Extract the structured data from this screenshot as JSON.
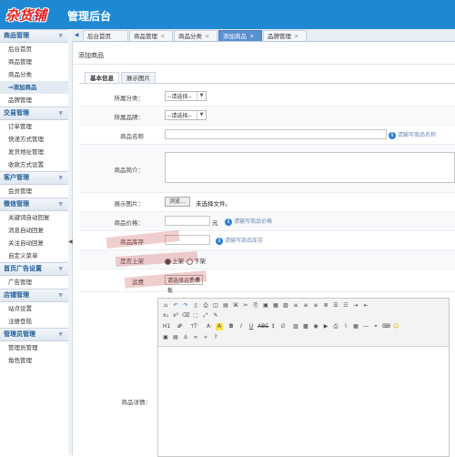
{
  "header": {
    "logo": "杂货铺",
    "title": "管理后台"
  },
  "sidebar": {
    "groups": [
      {
        "label": "商品管理",
        "items": [
          "后台首页",
          "商品管理",
          "商品分类",
          "添加商品",
          "品牌管理"
        ]
      },
      {
        "label": "交易管理",
        "items": [
          "订单管理",
          "快递方式管理",
          "发货地址管理",
          "收款方式设置"
        ]
      },
      {
        "label": "客户管理",
        "items": [
          "会员管理"
        ]
      },
      {
        "label": "微信管理",
        "items": [
          "关键词自动回复",
          "消息自动回复",
          "关注自动回复",
          "自定义菜单"
        ]
      },
      {
        "label": "首页广告设置",
        "items": [
          "广告管理"
        ]
      },
      {
        "label": "店铺管理",
        "items": [
          "站点设置",
          "注册登陆"
        ]
      },
      {
        "label": "管理员管理",
        "items": [
          "管理员管理",
          "角色管理"
        ]
      }
    ],
    "active_item": "添加商品"
  },
  "tabs": [
    {
      "label": "后台首页",
      "closable": false,
      "active": false
    },
    {
      "label": "商品管理",
      "closable": true,
      "active": false
    },
    {
      "label": "商品分类",
      "closable": true,
      "active": false
    },
    {
      "label": "添加商品",
      "closable": true,
      "active": true
    },
    {
      "label": "品牌管理",
      "closable": true,
      "active": false
    }
  ],
  "page": {
    "title": "添加商品",
    "subtabs": [
      "基本信息",
      "展示图片"
    ],
    "fields": {
      "category_label": "所属分类：",
      "category_value": "--请选择--",
      "brand_label": "所属品牌：",
      "brand_value": "--请选择--",
      "name_label": "商品名称",
      "name_tip": "请输写商品名称",
      "intro_label": "商品简介：",
      "image_label": "展示图片：",
      "browse_label": "浏览...",
      "no_file_text": "未选择文件。",
      "price_label": "商品价格：",
      "price_unit": "元",
      "price_tip": "请输写商品价格",
      "stock_label": "商品库存",
      "stock_tip": "请输写商品库存",
      "status_label": "是否上架",
      "status_yes": "上架",
      "status_no": "下架",
      "carrier_label": "运费",
      "carrier_value": "请选择运费模板",
      "detail_label": "商品详情："
    }
  },
  "colors": {
    "header_bg": "#1e88d3",
    "active_tab": "#5b8fd1",
    "logo_red": "#e02020"
  }
}
